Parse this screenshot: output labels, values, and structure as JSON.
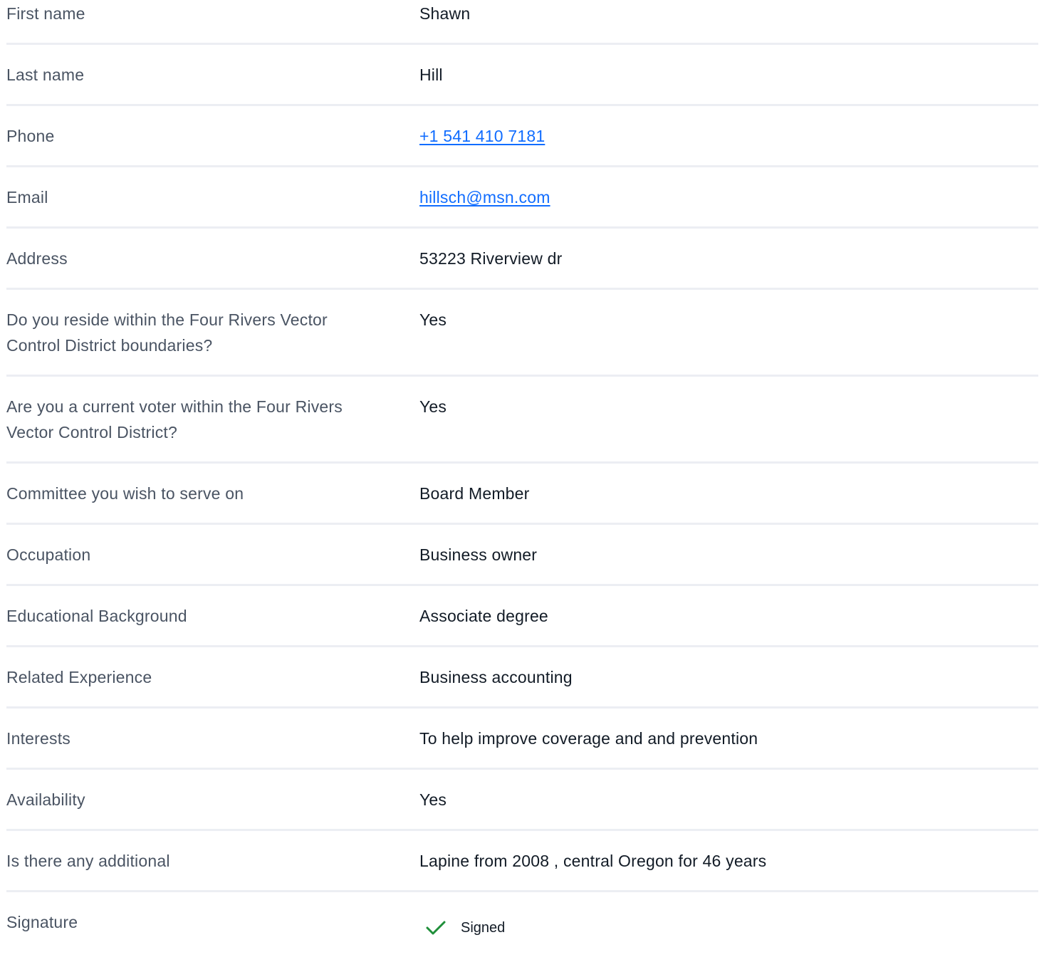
{
  "fields": [
    {
      "label": "First name",
      "value": "Shawn"
    },
    {
      "label": "Last name",
      "value": "Hill"
    },
    {
      "label": "Phone",
      "value": "+1 541 410 7181"
    },
    {
      "label": "Email",
      "value": "hillsch@msn.com"
    },
    {
      "label": "Address",
      "value": "53223 Riverview dr"
    },
    {
      "label": "Do you reside within the Four Rivers Vector Control District boundaries?",
      "value": "Yes"
    },
    {
      "label": "Are you a current voter within the Four Rivers Vector Control District?",
      "value": "Yes"
    },
    {
      "label": "Committee you wish to serve on",
      "value": "Board Member"
    },
    {
      "label": "Occupation",
      "value": "Business owner"
    },
    {
      "label": "Educational Background",
      "value": "Associate degree"
    },
    {
      "label": "Related Experience",
      "value": "Business accounting"
    },
    {
      "label": "Interests",
      "value": "To help improve coverage and and prevention"
    },
    {
      "label": "Availability",
      "value": "Yes"
    },
    {
      "label": "Is there any additional",
      "value": "Lapine from 2008 , central Oregon for 46 years"
    },
    {
      "label": "Signature",
      "value": "Signed"
    }
  ],
  "colors": {
    "link": "#116dff",
    "check": "#1f8f3a",
    "divider": "#eceef3"
  },
  "icons": {
    "signature_status": "check-icon"
  }
}
